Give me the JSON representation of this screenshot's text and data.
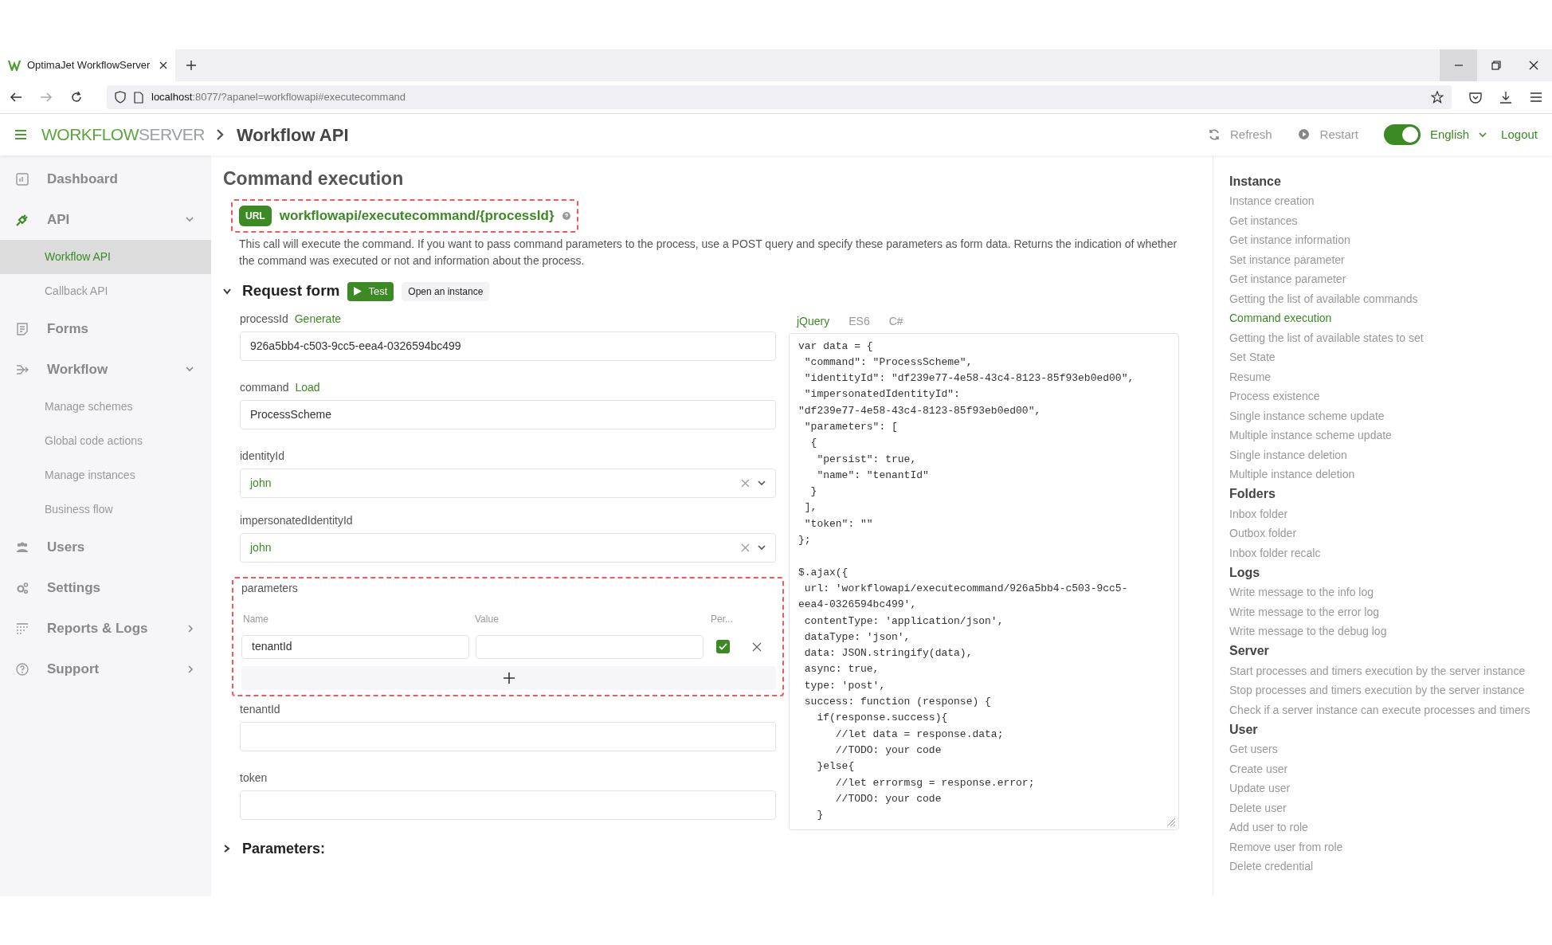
{
  "browser": {
    "tab_title": "OptimaJet WorkflowServer",
    "url_host": "localhost",
    "url_path": ":8077/?apanel=workflowapi#executecommand"
  },
  "header": {
    "logo_primary": "WORKFLOW",
    "logo_secondary": "SERVER",
    "breadcrumb": "Workflow API",
    "actions": [
      {
        "label": "Refresh"
      },
      {
        "label": "Restart"
      }
    ],
    "theme_toggle": {
      "on": true
    },
    "language": "English",
    "logout": "Logout"
  },
  "sidebar": {
    "items": [
      {
        "label": "Dashboard",
        "selected": false
      },
      {
        "label": "API",
        "selected": true,
        "expanded": true,
        "children": [
          {
            "label": "Workflow API",
            "selected": true
          },
          {
            "label": "Callback API",
            "selected": false
          }
        ]
      },
      {
        "label": "Forms",
        "selected": false
      },
      {
        "label": "Workflow",
        "selected": false,
        "expanded": true,
        "children": [
          {
            "label": "Manage schemes",
            "selected": false
          },
          {
            "label": "Global code actions",
            "selected": false
          },
          {
            "label": "Manage instances",
            "selected": false
          },
          {
            "label": "Business flow",
            "selected": false
          }
        ]
      },
      {
        "label": "Users",
        "selected": false
      },
      {
        "label": "Settings",
        "selected": false
      },
      {
        "label": "Reports & Logs",
        "selected": false,
        "expanded": false
      },
      {
        "label": "Support",
        "selected": false,
        "expanded": false
      }
    ]
  },
  "main": {
    "title": "Command execution",
    "endpoint": {
      "badge": "URL",
      "path": "workflowapi/executecommand/{processId}",
      "highlighted": true
    },
    "description": "This call will execute the command. If you want to pass command parameters to the process, use a POST query and specify these parameters as form data. Returns the indication of whether the command was executed or not and information about the process.",
    "request_form": {
      "title": "Request form",
      "expanded": true,
      "test_button": "Test",
      "open_button": "Open an instance",
      "fields": [
        {
          "kind": "input",
          "label": "processId",
          "action": "Generate",
          "value": "926a5bb4-c503-9cc5-eea4-0326594bc499"
        },
        {
          "kind": "input",
          "label": "command",
          "action": "Load",
          "value": "ProcessScheme"
        },
        {
          "kind": "select",
          "label": "identityId",
          "value": "john"
        },
        {
          "kind": "select",
          "label": "impersonatedIdentityId",
          "value": "john"
        },
        {
          "kind": "table",
          "label": "parameters",
          "highlighted": true,
          "columns": [
            "Name",
            "Value",
            "Per..."
          ],
          "rows": [
            {
              "name": "tenantId",
              "persist": true
            }
          ]
        },
        {
          "kind": "input",
          "label": "tenantId"
        },
        {
          "kind": "input",
          "label": "token"
        }
      ]
    },
    "code": {
      "tabs": [
        {
          "label": "jQuery",
          "selected": true
        },
        {
          "label": "ES6",
          "selected": false
        },
        {
          "label": "C#",
          "selected": false
        }
      ],
      "blocks": [
        [
          "var data = {",
          " \"command\": \"ProcessScheme\",",
          " \"identityId\": \"df239e77-4e58-43c4-8123-85f93eb0ed00\",",
          " \"impersonatedIdentityId\":",
          "\"df239e77-4e58-43c4-8123-85f93eb0ed00\",",
          " \"parameters\": [",
          "  {",
          "   \"persist\": true,",
          "   \"name\": \"tenantId\"",
          "  }",
          " ],",
          " \"token\": \"\"",
          "};"
        ],
        [
          "$.ajax({",
          " url: 'workflowapi/executecommand/926a5bb4-c503-9cc5-",
          "eea4-0326594bc499',",
          " contentType: 'application/json',",
          " dataType: 'json',",
          " data: JSON.stringify(data),",
          " async: true,",
          " type: 'post',",
          " success: function (response) {",
          "   if(response.success){",
          "      //let data = response.data;",
          "      //TODO: your code",
          "   }else{",
          "      //let errormsg = response.error;",
          "      //TODO: your code",
          "   }"
        ]
      ]
    },
    "parameters_section": {
      "title": "Parameters:",
      "expanded": false
    }
  },
  "toc": {
    "groups": [
      {
        "title": "Instance",
        "items": [
          {
            "label": "Instance creation",
            "selected": false
          },
          {
            "label": "Get instances",
            "selected": false
          },
          {
            "label": "Get instance information",
            "selected": false
          },
          {
            "label": "Set instance parameter",
            "selected": false
          },
          {
            "label": "Get instance parameter",
            "selected": false
          },
          {
            "label": "Getting the list of available commands",
            "selected": false
          },
          {
            "label": "Command execution",
            "selected": true
          },
          {
            "label": "Getting the list of available states to set",
            "selected": false
          },
          {
            "label": "Set State",
            "selected": false
          },
          {
            "label": "Resume",
            "selected": false
          },
          {
            "label": "Process existence",
            "selected": false
          },
          {
            "label": "Single instance scheme update",
            "selected": false
          },
          {
            "label": "Multiple instance scheme update",
            "selected": false
          },
          {
            "label": "Single instance deletion",
            "selected": false
          },
          {
            "label": "Multiple instance deletion",
            "selected": false
          }
        ]
      },
      {
        "title": "Folders",
        "items": [
          {
            "label": "Inbox folder",
            "selected": false
          },
          {
            "label": "Outbox folder",
            "selected": false
          },
          {
            "label": "Inbox folder recalc",
            "selected": false
          }
        ]
      },
      {
        "title": "Logs",
        "items": [
          {
            "label": "Write message to the info log",
            "selected": false
          },
          {
            "label": "Write message to the error log",
            "selected": false
          },
          {
            "label": "Write message to the debug log",
            "selected": false
          }
        ]
      },
      {
        "title": "Server",
        "items": [
          {
            "label": "Start processes and timers execution by the server instance",
            "selected": false
          },
          {
            "label": "Stop processes and timers execution by the server instance",
            "selected": false
          },
          {
            "label": "Check if a server instance can execute processes and timers",
            "selected": false
          }
        ]
      },
      {
        "title": "User",
        "items": [
          {
            "label": "Get users",
            "selected": false
          },
          {
            "label": "Create user",
            "selected": false
          },
          {
            "label": "Update user",
            "selected": false
          },
          {
            "label": "Delete user",
            "selected": false
          },
          {
            "label": "Add user to role",
            "selected": false
          },
          {
            "label": "Remove user from role",
            "selected": false
          },
          {
            "label": "Delete credential",
            "selected": false
          }
        ]
      }
    ]
  }
}
